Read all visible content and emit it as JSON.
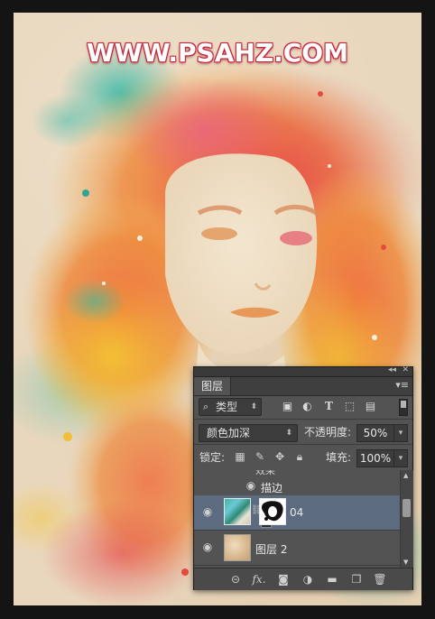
{
  "watermark": "WWW.PSAHZ.COM",
  "panel": {
    "tab_label": "图层",
    "filter": {
      "label": "类型",
      "icon": "search-icon"
    },
    "filter_icons": [
      "image-filter-icon",
      "adjustment-filter-icon",
      "type-filter-icon",
      "shape-filter-icon",
      "smart-object-filter-icon"
    ],
    "blend_mode": "颜色加深",
    "opacity_label": "不透明度:",
    "opacity_value": "50%",
    "lock_label": "锁定:",
    "fill_label": "填充:",
    "fill_value": "100%",
    "effects_partial_label": "效果",
    "stroke_effect_label": "描边",
    "layers": [
      {
        "name": "04",
        "selected": true,
        "has_mask": true,
        "visible": true
      },
      {
        "name": "图层 2",
        "selected": false,
        "has_mask": false,
        "visible": true
      }
    ],
    "bottom_icons": [
      "link-layers-icon",
      "fx-icon",
      "add-mask-icon",
      "adjustment-layer-icon",
      "new-group-icon",
      "new-layer-icon",
      "delete-layer-icon"
    ],
    "fx_text": "fx."
  },
  "colors": {
    "panel_bg": "#535353",
    "selected_row": "#5c6b80",
    "watermark_outline": "#c6243a"
  }
}
